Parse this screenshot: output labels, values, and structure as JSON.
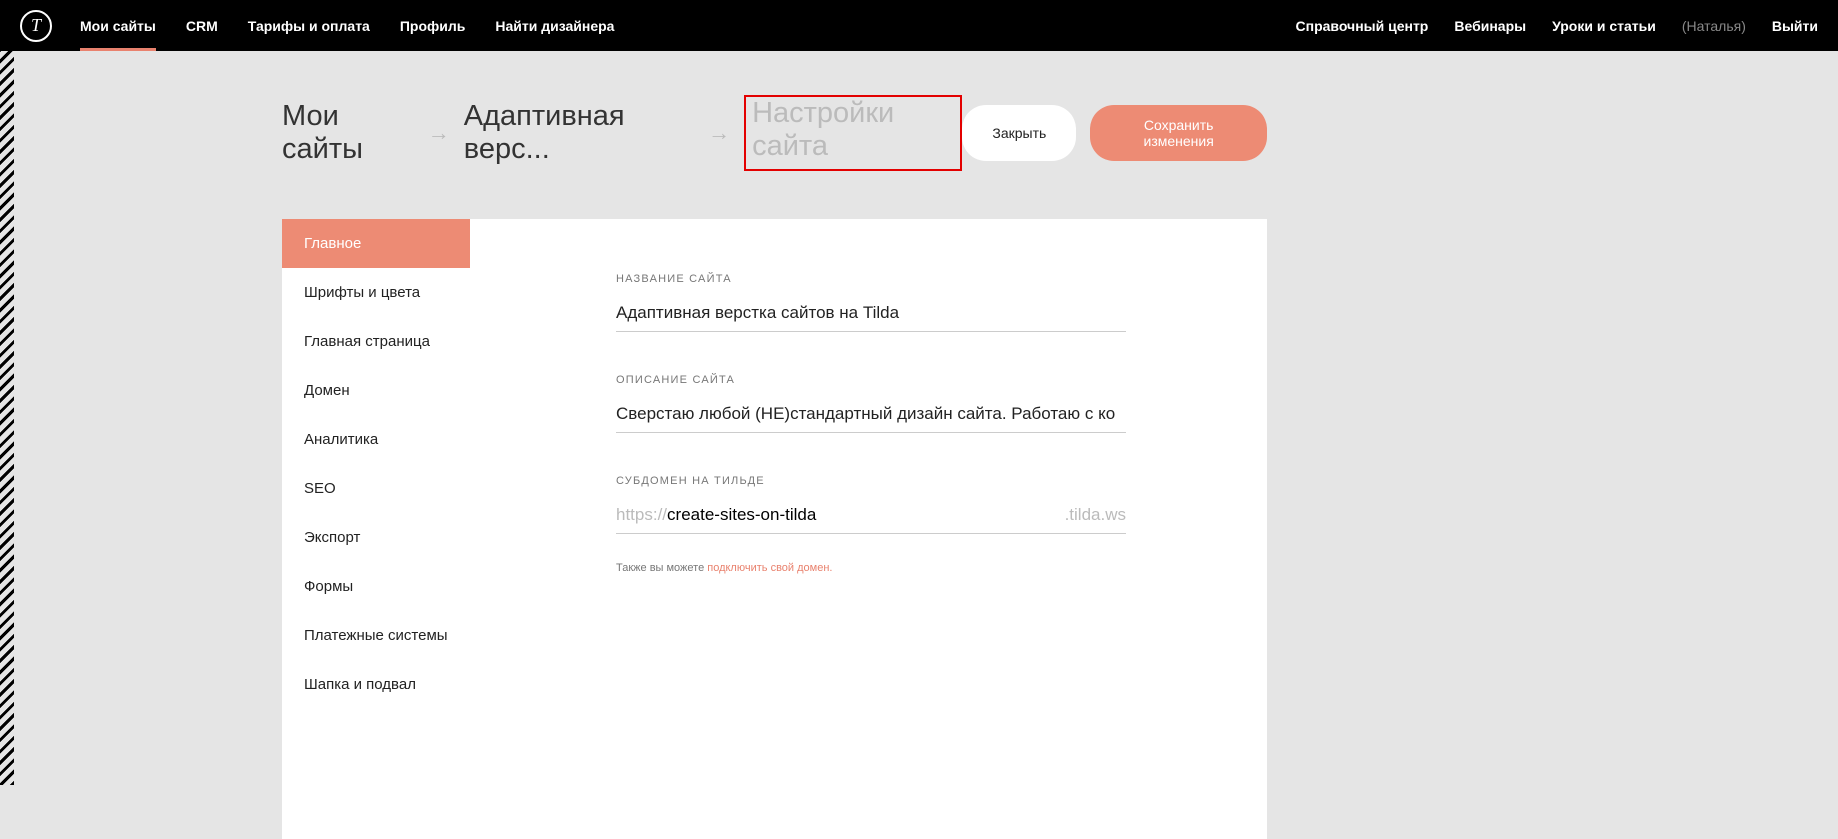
{
  "topnav": {
    "logo": "T",
    "left": [
      "Мои сайты",
      "CRM",
      "Тарифы и оплата",
      "Профиль",
      "Найти дизайнера"
    ],
    "right": [
      "Справочный центр",
      "Вебинары",
      "Уроки и статьи"
    ],
    "user": "(Наталья)",
    "logout": "Выйти"
  },
  "breadcrumb": {
    "root": "Мои сайты",
    "site": "Адаптивная верс...",
    "current": "Настройки сайта"
  },
  "buttons": {
    "close": "Закрыть",
    "save": "Сохранить изменения"
  },
  "sidebar": [
    "Главное",
    "Шрифты и цвета",
    "Главная страница",
    "Домен",
    "Аналитика",
    "SEO",
    "Экспорт",
    "Формы",
    "Платежные системы",
    "Шапка и подвал"
  ],
  "form": {
    "site_name_label": "НАЗВАНИЕ САЙТА",
    "site_name_value": "Адаптивная верстка сайтов на Tilda",
    "site_desc_label": "ОПИСАНИЕ САЙТА",
    "site_desc_value": "Сверстаю любой (НЕ)стандартный дизайн сайта. Работаю с ко",
    "subdomain_label": "СУБДОМЕН НА ТИЛЬДЕ",
    "subdomain_prefix": "https://",
    "subdomain_value": "create-sites-on-tilda",
    "subdomain_suffix": ".tilda.ws",
    "hint_text": "Также вы можете ",
    "hint_link": "подключить свой домен."
  }
}
